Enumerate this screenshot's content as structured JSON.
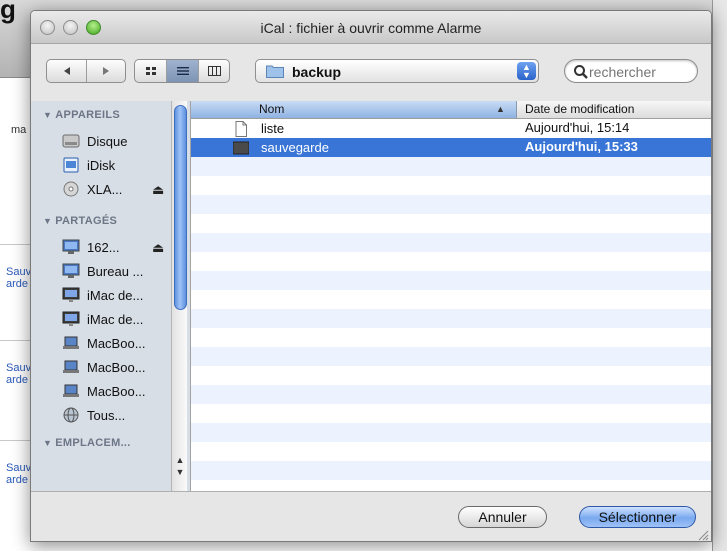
{
  "window": {
    "title": "iCal : fichier à ouvrir comme Alarme"
  },
  "toolbar": {
    "back_icon": "back-arrow-icon",
    "forward_icon": "forward-arrow-icon",
    "view_modes": [
      "icon-view",
      "list-view",
      "column-view"
    ],
    "location": "backup",
    "search_placeholder": "rechercher"
  },
  "sidebar": {
    "sections": [
      {
        "heading": "APPAREILS",
        "items": [
          {
            "label": "Disque",
            "icon": "hard-disk-icon",
            "eject": false
          },
          {
            "label": "iDisk",
            "icon": "idisk-icon",
            "eject": false
          },
          {
            "label": "XLA...",
            "icon": "cd-icon",
            "eject": true
          }
        ]
      },
      {
        "heading": "PARTAGÉS",
        "items": [
          {
            "label": "162...",
            "icon": "shared-computer-icon",
            "eject": true
          },
          {
            "label": "Bureau ...",
            "icon": "shared-computer-icon",
            "eject": false
          },
          {
            "label": "iMac de...",
            "icon": "imac-icon",
            "eject": false
          },
          {
            "label": "iMac de...",
            "icon": "imac-icon",
            "eject": false
          },
          {
            "label": "MacBoo...",
            "icon": "laptop-icon",
            "eject": false
          },
          {
            "label": "MacBoo...",
            "icon": "laptop-icon",
            "eject": false
          },
          {
            "label": "MacBoo...",
            "icon": "laptop-icon",
            "eject": false
          },
          {
            "label": "Tous...",
            "icon": "network-globe-icon",
            "eject": false
          }
        ]
      },
      {
        "heading": "EMPLACEM..."
      }
    ]
  },
  "filelist": {
    "columns": {
      "name": "Nom",
      "date": "Date de modification"
    },
    "rows": [
      {
        "name": "liste",
        "date": "Aujourd'hui, 15:14",
        "icon": "document-icon",
        "selected": false
      },
      {
        "name": "sauvegarde",
        "date": "Aujourd'hui, 15:33",
        "icon": "dark-file-icon",
        "selected": true
      }
    ]
  },
  "buttons": {
    "cancel": "Annuler",
    "select": "Sélectionner"
  },
  "background_app": {
    "heading": "g",
    "snippets": [
      "ma",
      "Sauv arde",
      "Sauv arde",
      "Sauv arde"
    ]
  },
  "colors": {
    "selection": "#3875d7",
    "sidebar": "#d8dee6",
    "alt_row": "#edf3fe"
  }
}
